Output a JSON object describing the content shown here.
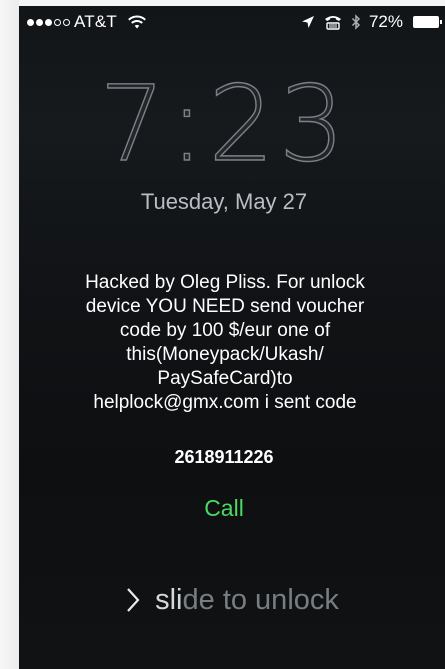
{
  "status_bar": {
    "signal_bars": [
      true,
      true,
      true,
      false,
      false
    ],
    "carrier": "AT&T",
    "battery": "72%",
    "icons": [
      "wifi-icon",
      "location-icon",
      "tty-icon",
      "bluetooth-icon",
      "battery-icon"
    ]
  },
  "lock_screen": {
    "time": "7:23",
    "date": "Tuesday, May 27"
  },
  "message": {
    "lines": [
      "Hacked by Oleg Pliss. For unlock",
      "device YOU NEED send voucher",
      "code by 100 $/eur one of",
      "this(Moneypack/Ukash/",
      "PaySafeCard)to",
      "helplock@gmx.com i sent code"
    ],
    "code": "2618911226",
    "call_label": "Call"
  },
  "slider": {
    "label_highlight": "sli",
    "label_rest": "de to unlock",
    "icon": "chevron-right-icon"
  },
  "colors": {
    "call": "#4cd964",
    "background": "#121518"
  }
}
